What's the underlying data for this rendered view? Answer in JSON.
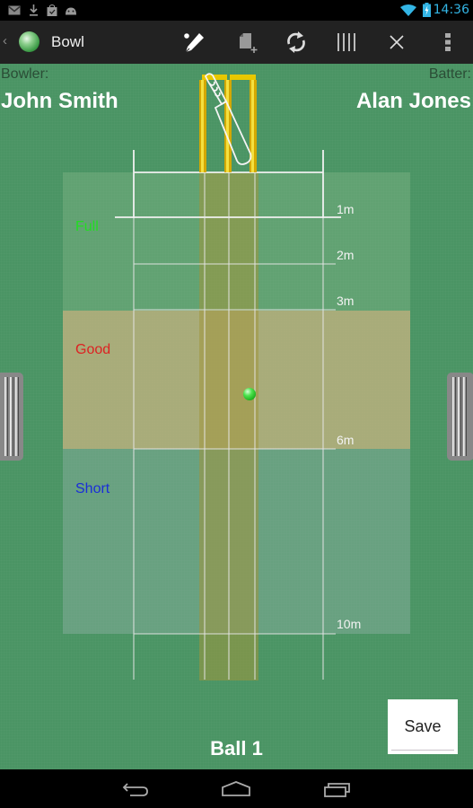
{
  "status_bar": {
    "time": "14:36",
    "left_icons": [
      "gmail-icon",
      "download-icon",
      "store-bag-icon",
      "android-icon"
    ],
    "right_icons": [
      "wifi-icon",
      "battery-charging-icon"
    ]
  },
  "action_bar": {
    "title": "Bowl",
    "actions": [
      {
        "name": "edit-pencil",
        "label": "Edit"
      },
      {
        "name": "new-document",
        "label": "New"
      },
      {
        "name": "switch-sync",
        "label": "Switch"
      },
      {
        "name": "stumps-lines",
        "label": "Stumps"
      },
      {
        "name": "close",
        "label": "Close"
      },
      {
        "name": "overflow-menu",
        "label": "More"
      }
    ]
  },
  "players": {
    "bowler_label": "Bowler:",
    "bowler_name": "John Smith",
    "batter_label": "Batter:",
    "batter_name": "Alan Jones"
  },
  "zones": {
    "full": {
      "label": "Full",
      "color": "#22dd22"
    },
    "good": {
      "label": "Good",
      "color": "#dd2222"
    },
    "short": {
      "label": "Short",
      "color": "#1a2ed8"
    }
  },
  "distance_markers": [
    "1m",
    "2m",
    "3m",
    "6m",
    "10m"
  ],
  "ball": {
    "label": "Ball 1",
    "color": "#22cc22"
  },
  "save_button": {
    "label": "Save"
  },
  "nav_bar": {
    "buttons": [
      "back",
      "home",
      "recent-apps"
    ]
  }
}
